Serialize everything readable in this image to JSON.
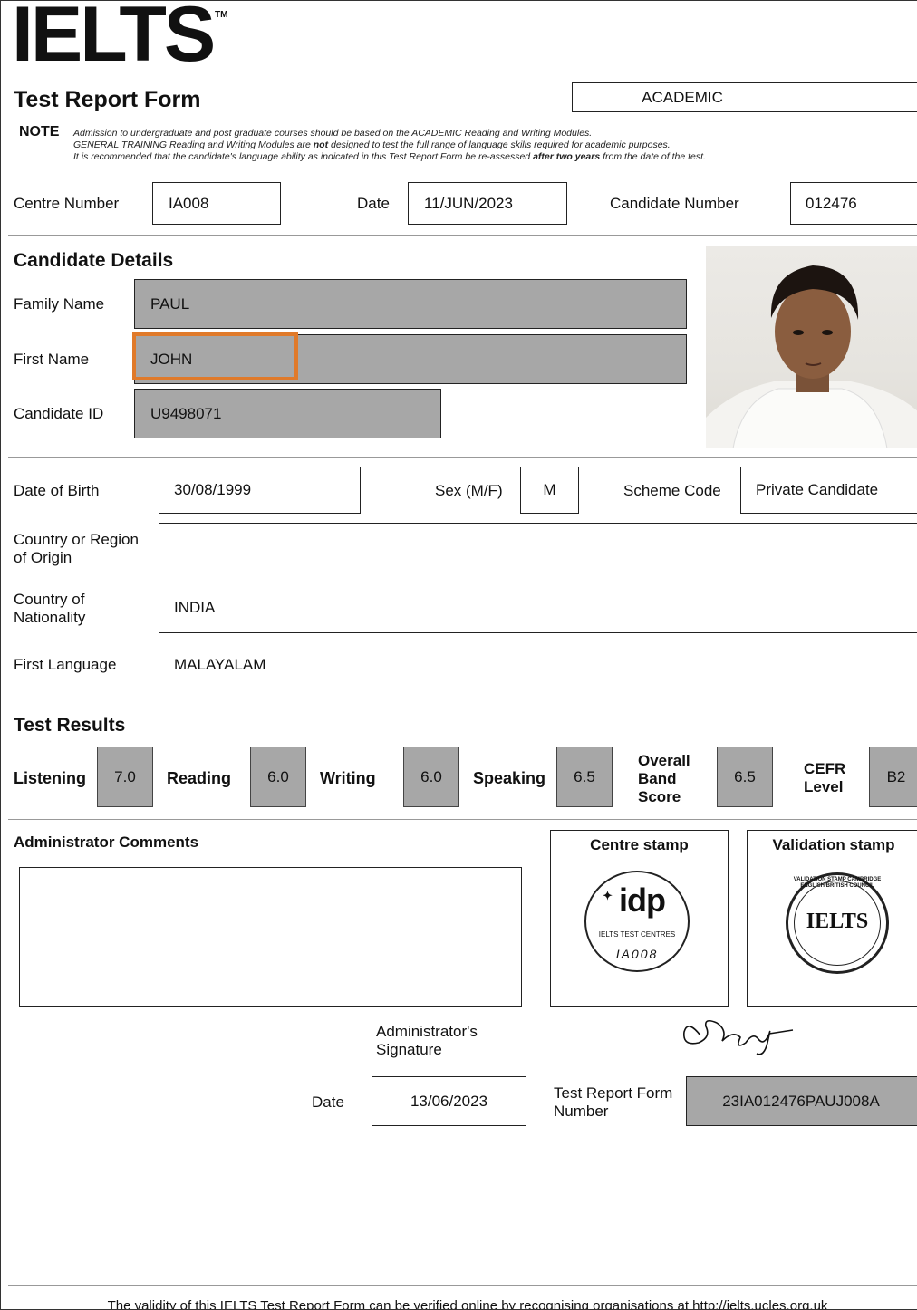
{
  "header": {
    "logo": "IELTS",
    "tm": "TM",
    "form_title": "Test Report Form",
    "module": "ACADEMIC",
    "note_label": "NOTE",
    "note_line1": "Admission to undergraduate and post graduate courses should be based on the ACADEMIC Reading and Writing Modules.",
    "note_line2_a": "GENERAL TRAINING Reading and Writing Modules are ",
    "note_line2_b": "not",
    "note_line2_c": " designed to test the full range of language skills required for academic purposes.",
    "note_line3_a": "It is recommended that the candidate's language ability as indicated in this Test Report Form be re-assessed ",
    "note_line3_b": "after two years",
    "note_line3_c": " from the date of the test."
  },
  "centre": {
    "centre_number_label": "Centre Number",
    "centre_number": "IA008",
    "date_label": "Date",
    "date": "11/JUN/2023",
    "candidate_number_label": "Candidate Number",
    "candidate_number": "012476"
  },
  "candidate": {
    "section_title": "Candidate Details",
    "family_name_label": "Family Name",
    "family_name": "PAUL",
    "first_name_label": "First Name",
    "first_name": "JOHN",
    "candidate_id_label": "Candidate ID",
    "candidate_id": "U9498071"
  },
  "personal": {
    "dob_label": "Date of Birth",
    "dob": "30/08/1999",
    "sex_label": "Sex (M/F)",
    "sex": "M",
    "scheme_label": "Scheme Code",
    "scheme": "Private Candidate",
    "origin_label_1": "Country or Region",
    "origin_label_2": "of Origin",
    "origin": "",
    "nationality_label_1": "Country of",
    "nationality_label_2": "Nationality",
    "nationality": "INDIA",
    "language_label": "First Language",
    "language": "MALAYALAM"
  },
  "results": {
    "section_title": "Test Results",
    "listening_label": "Listening",
    "listening": "7.0",
    "reading_label": "Reading",
    "reading": "6.0",
    "writing_label": "Writing",
    "writing": "6.0",
    "speaking_label": "Speaking",
    "speaking": "6.5",
    "overall_label_1": "Overall",
    "overall_label_2": "Band",
    "overall_label_3": "Score",
    "overall": "6.5",
    "cefr_label_1": "CEFR",
    "cefr_label_2": "Level",
    "cefr": "B2"
  },
  "admin": {
    "comments_label": "Administrator Comments",
    "comments": "",
    "centre_stamp_label": "Centre stamp",
    "validation_stamp_label": "Validation stamp",
    "idp_text": "idp",
    "idp_sub": "IELTS TEST CENTRES",
    "idp_code": "IA008",
    "val_ring_text": "VALIDATION STAMP CAMBRIDGE ENGLISH/BRITISH COUNCIL",
    "val_center": "IELTS",
    "signature_label_1": "Administrator's",
    "signature_label_2": "Signature",
    "date_label": "Date",
    "date": "13/06/2023",
    "trf_label_1": "Test Report Form",
    "trf_label_2": "Number",
    "trf_number": "23IA012476PAUJ008A"
  },
  "footer": {
    "text": "The validity of this IELTS Test Report Form can be verified online by recognising organisations at http://ielts.ucles.org.uk"
  },
  "colors": {
    "highlight": "#e07a2a",
    "grey_field": "#a7a7a7"
  }
}
